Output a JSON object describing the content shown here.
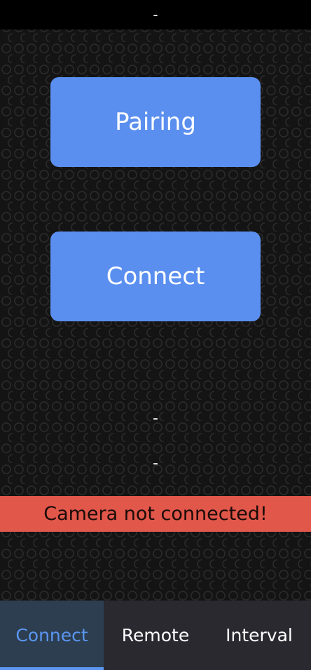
{
  "colors": {
    "button_bg": "#5a8ff0",
    "error_bg": "#e1574a",
    "active_tab_text": "#5b96f1",
    "active_tab_indicator": "#5b96f1"
  },
  "header": {
    "status": "-"
  },
  "actions": {
    "pairing_label": "Pairing",
    "connect_label": "Connect"
  },
  "status": {
    "line1": "-",
    "line2": "-",
    "error": "Camera not connected!"
  },
  "nav": {
    "tabs": [
      {
        "label": "Connect",
        "active": true
      },
      {
        "label": "Remote",
        "active": false
      },
      {
        "label": "Interval",
        "active": false
      }
    ]
  }
}
